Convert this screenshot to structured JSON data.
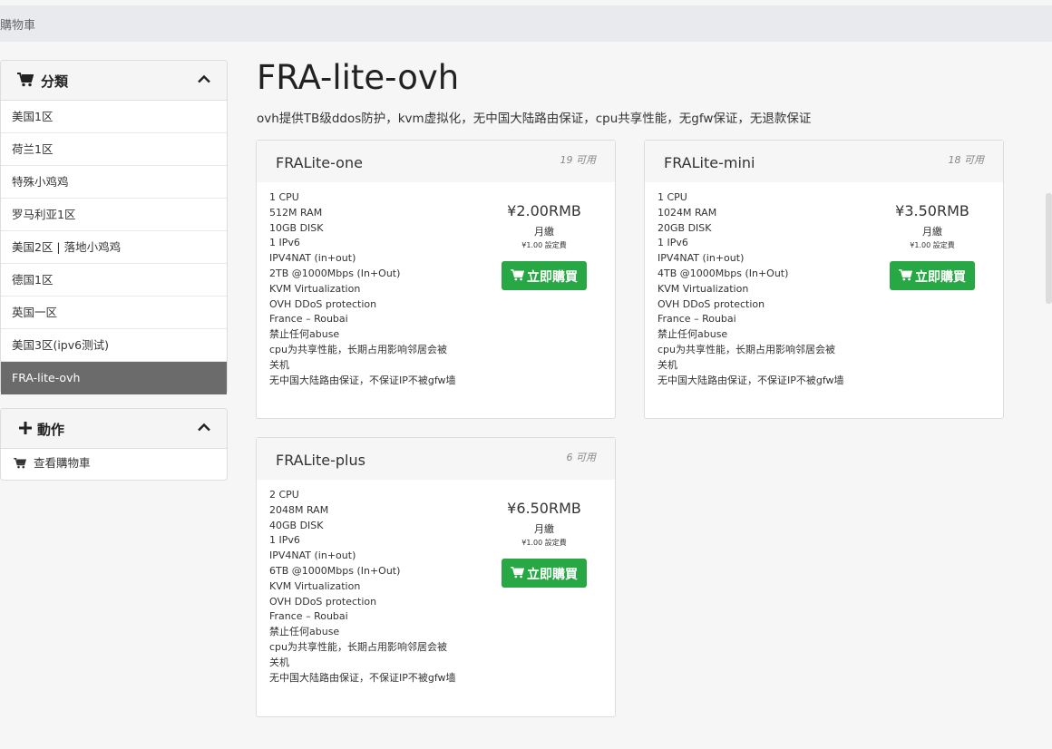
{
  "breadcrumb": "購物車",
  "sidebar": {
    "categories_title": "分類",
    "categories": [
      {
        "label": "美国1区"
      },
      {
        "label": "荷兰1区"
      },
      {
        "label": "特殊小鸡鸡"
      },
      {
        "label": "罗马利亚1区"
      },
      {
        "label": "美国2区 | 落地小鸡鸡"
      },
      {
        "label": "德国1区"
      },
      {
        "label": "英国一区"
      },
      {
        "label": "美国3区(ipv6测试)"
      },
      {
        "label": "FRA-lite-ovh"
      }
    ],
    "active_category": "FRA-lite-ovh",
    "actions_title": "動作",
    "actions": [
      {
        "label": "查看購物車"
      }
    ]
  },
  "main": {
    "title": "FRA-lite-ovh",
    "description": "ovh提供TB级ddos防护，kvm虚拟化，无中国大陆路由保证，cpu共享性能，无gfw保证，无退款保证",
    "products": [
      {
        "name": "FRALite-one",
        "stock": "19 可用",
        "specs": [
          "1 CPU",
          "512M RAM",
          "10GB DISK",
          "1 IPv6",
          "IPV4NAT (in+out)",
          "2TB @1000Mbps (In+Out)",
          "KVM Virtualization",
          "OVH DDoS protection",
          "France – Roubai",
          "禁止任何abuse",
          "cpu为共享性能，长期占用影响邻居会被",
          "关机",
          "无中国大陆路由保证，不保证IP不被gfw墙"
        ],
        "price": "¥2.00RMB",
        "cycle": "月繳",
        "setup_fee": "¥1.00 設定費",
        "button": "立即購買"
      },
      {
        "name": "FRALite-mini",
        "stock": "18 可用",
        "specs": [
          "1 CPU",
          "1024M RAM",
          "20GB DISK",
          "1 IPv6",
          "IPV4NAT (in+out)",
          "4TB @1000Mbps (In+Out)",
          "KVM Virtualization",
          "OVH DDoS protection",
          "France – Roubai",
          "禁止任何abuse",
          "cpu为共享性能，长期占用影响邻居会被",
          "关机",
          "无中国大陆路由保证，不保证IP不被gfw墙"
        ],
        "price": "¥3.50RMB",
        "cycle": "月繳",
        "setup_fee": "¥1.00 設定費",
        "button": "立即購買"
      },
      {
        "name": "FRALite-plus",
        "stock": "6 可用",
        "specs": [
          "2 CPU",
          "2048M RAM",
          "40GB DISK",
          "1 IPv6",
          "IPV4NAT (in+out)",
          "6TB @1000Mbps (In+Out)",
          "KVM Virtualization",
          "OVH DDoS protection",
          "France – Roubai",
          "禁止任何abuse",
          "cpu为共享性能，长期占用影响邻居会被",
          "关机",
          "无中国大陆路由保证，不保证IP不被gfw墙"
        ],
        "price": "¥6.50RMB",
        "cycle": "月繳",
        "setup_fee": "¥1.00 設定費",
        "button": "立即購買"
      }
    ]
  },
  "colors": {
    "buy_button": "#28a745",
    "active_item": "#6b6b6b"
  }
}
